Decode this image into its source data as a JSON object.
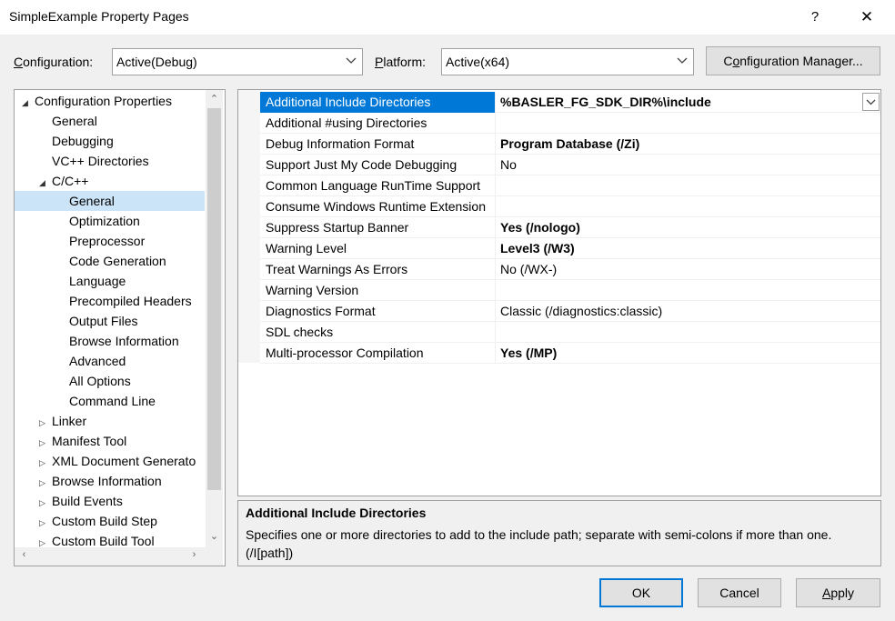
{
  "window": {
    "title": "SimpleExample Property Pages",
    "help_label": "?",
    "close_label": "✕"
  },
  "config_row": {
    "configuration_label_pre": "",
    "configuration_label_ul": "C",
    "configuration_label_post": "onfiguration:",
    "configuration_value": "Active(Debug)",
    "platform_label_ul": "P",
    "platform_label_post": "latform:",
    "platform_value": "Active(x64)",
    "manager_ul": "o",
    "manager_pre": "C",
    "manager_post": "nfiguration Manager..."
  },
  "tree": {
    "items": [
      {
        "label": "Configuration Properties",
        "level": 0,
        "expander": "expanded"
      },
      {
        "label": "General",
        "level": 1,
        "expander": "none"
      },
      {
        "label": "Debugging",
        "level": 1,
        "expander": "none"
      },
      {
        "label": "VC++ Directories",
        "level": 1,
        "expander": "none"
      },
      {
        "label": "C/C++",
        "level": 1,
        "expander": "expanded"
      },
      {
        "label": "General",
        "level": 2,
        "expander": "none",
        "selected": true
      },
      {
        "label": "Optimization",
        "level": 2,
        "expander": "none"
      },
      {
        "label": "Preprocessor",
        "level": 2,
        "expander": "none"
      },
      {
        "label": "Code Generation",
        "level": 2,
        "expander": "none"
      },
      {
        "label": "Language",
        "level": 2,
        "expander": "none"
      },
      {
        "label": "Precompiled Headers",
        "level": 2,
        "expander": "none"
      },
      {
        "label": "Output Files",
        "level": 2,
        "expander": "none"
      },
      {
        "label": "Browse Information",
        "level": 2,
        "expander": "none"
      },
      {
        "label": "Advanced",
        "level": 2,
        "expander": "none"
      },
      {
        "label": "All Options",
        "level": 2,
        "expander": "none"
      },
      {
        "label": "Command Line",
        "level": 2,
        "expander": "none"
      },
      {
        "label": "Linker",
        "level": 1,
        "expander": "collapsed"
      },
      {
        "label": "Manifest Tool",
        "level": 1,
        "expander": "collapsed"
      },
      {
        "label": "XML Document Generato",
        "level": 1,
        "expander": "collapsed"
      },
      {
        "label": "Browse Information",
        "level": 1,
        "expander": "collapsed"
      },
      {
        "label": "Build Events",
        "level": 1,
        "expander": "collapsed"
      },
      {
        "label": "Custom Build Step",
        "level": 1,
        "expander": "collapsed"
      },
      {
        "label": "Custom Build Tool",
        "level": 1,
        "expander": "collapsed"
      }
    ]
  },
  "grid": {
    "rows": [
      {
        "name": "Additional Include Directories",
        "value": "%BASLER_FG_SDK_DIR%\\include",
        "bold": true,
        "selected": true
      },
      {
        "name": "Additional #using Directories",
        "value": "",
        "bold": false
      },
      {
        "name": "Debug Information Format",
        "value": "Program Database (/Zi)",
        "bold": true
      },
      {
        "name": "Support Just My Code Debugging",
        "value": "No",
        "bold": false
      },
      {
        "name": "Common Language RunTime Support",
        "value": "",
        "bold": false
      },
      {
        "name": "Consume Windows Runtime Extension",
        "value": "",
        "bold": false
      },
      {
        "name": "Suppress Startup Banner",
        "value": "Yes (/nologo)",
        "bold": true
      },
      {
        "name": "Warning Level",
        "value": "Level3 (/W3)",
        "bold": true
      },
      {
        "name": "Treat Warnings As Errors",
        "value": "No (/WX-)",
        "bold": false
      },
      {
        "name": "Warning Version",
        "value": "",
        "bold": false
      },
      {
        "name": "Diagnostics Format",
        "value": "Classic (/diagnostics:classic)",
        "bold": false
      },
      {
        "name": "SDL checks",
        "value": "",
        "bold": false
      },
      {
        "name": "Multi-processor Compilation",
        "value": "Yes (/MP)",
        "bold": true
      }
    ]
  },
  "description": {
    "title": "Additional Include Directories",
    "text": "Specifies one or more directories to add to the include path; separate with semi-colons if more than one.     (/I[path])"
  },
  "buttons": {
    "ok": "OK",
    "cancel": "Cancel",
    "apply_ul": "A",
    "apply_post": "pply"
  }
}
